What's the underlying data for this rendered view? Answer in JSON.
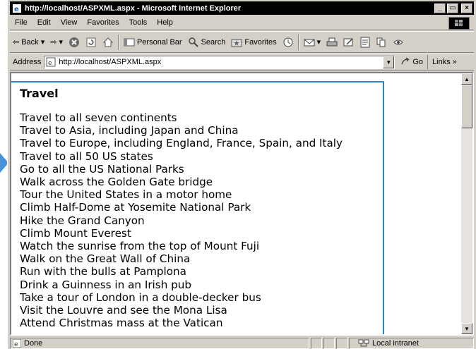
{
  "window": {
    "title": "http://localhost/ASPXML.aspx - Microsoft Internet Explorer",
    "minimize": "_",
    "maximize": "▭",
    "close": "×"
  },
  "menu": [
    "File",
    "Edit",
    "View",
    "Favorites",
    "Tools",
    "Help"
  ],
  "toolbar": {
    "back": "Back",
    "personal_bar": "Personal Bar",
    "search": "Search",
    "favorites": "Favorites"
  },
  "address": {
    "label": "Address",
    "url": "http://localhost/ASPXML.aspx",
    "go": "Go",
    "links": "Links »"
  },
  "content": {
    "title": "Travel",
    "items": [
      "Travel to all seven continents",
      "Travel to Asia, including Japan and China",
      "Travel to Europe, including England, France, Spain, and Italy",
      "Travel to all 50 US states",
      "Go to all the US National Parks",
      "Walk across the Golden Gate bridge",
      "Tour the United States in a motor home",
      "Climb Half-Dome at Yosemite National Park",
      "Hike the Grand Canyon",
      "Climb Mount Everest",
      "Watch the sunrise from the top of Mount Fuji",
      "Walk on the Great Wall of China",
      "Run with the bulls at Pamplona",
      "Drink a Guinness in an Irish pub",
      "Take a tour of London in a double-decker bus",
      "Visit the Louvre and see the Mona Lisa",
      "Attend Christmas mass at the Vatican"
    ]
  },
  "status": {
    "text": "Done",
    "zone": "Local intranet"
  },
  "colors": {
    "accent_box": "#2f86c6",
    "pointer": "#4a90d9"
  }
}
